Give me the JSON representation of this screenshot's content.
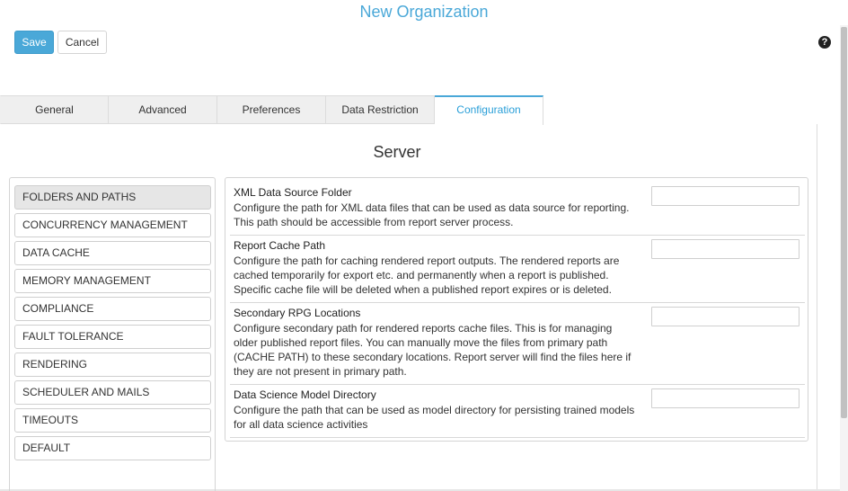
{
  "header": {
    "title": "New Organization",
    "save_label": "Save",
    "cancel_label": "Cancel",
    "help_icon": "?"
  },
  "tabs": [
    {
      "label": "General"
    },
    {
      "label": "Advanced"
    },
    {
      "label": "Preferences"
    },
    {
      "label": "Data Restriction"
    },
    {
      "label": "Configuration",
      "active": true
    }
  ],
  "section_title": "Server",
  "sidebar": {
    "items": [
      {
        "label": "FOLDERS AND PATHS",
        "active": true
      },
      {
        "label": "CONCURRENCY MANAGEMENT"
      },
      {
        "label": "DATA CACHE"
      },
      {
        "label": "MEMORY MANAGEMENT"
      },
      {
        "label": "COMPLIANCE"
      },
      {
        "label": "FAULT TOLERANCE"
      },
      {
        "label": "RENDERING"
      },
      {
        "label": "SCHEDULER AND MAILS"
      },
      {
        "label": "TIMEOUTS"
      },
      {
        "label": "DEFAULT"
      }
    ]
  },
  "settings": [
    {
      "label": "XML Data Source Folder",
      "description": "Configure the path for XML data files that can be used as data source for reporting. This path should be accessible from report server process.",
      "value": ""
    },
    {
      "label": "Report Cache Path",
      "description": "Configure the path for caching rendered report outputs. The rendered reports are cached temporarily for export etc. and permanently when a report is published. Specific cache file will be deleted when a published report expires or is deleted.",
      "value": ""
    },
    {
      "label": "Secondary RPG Locations",
      "description": "Configure secondary path for rendered reports cache files. This is for managing older published report files. You can manually move the files from primary path (CACHE PATH) to these secondary locations. Report server will find the files here if they are not present in primary path.",
      "value": ""
    },
    {
      "label": "Data Science Model Directory",
      "description": "Configure the path that can be used as model directory for persisting trained models for all data science activities",
      "value": ""
    }
  ],
  "colors": {
    "accent": "#4aa8d8",
    "tab_inactive_bg": "#efefef",
    "sidebar_active_bg": "#e6e6e6"
  }
}
